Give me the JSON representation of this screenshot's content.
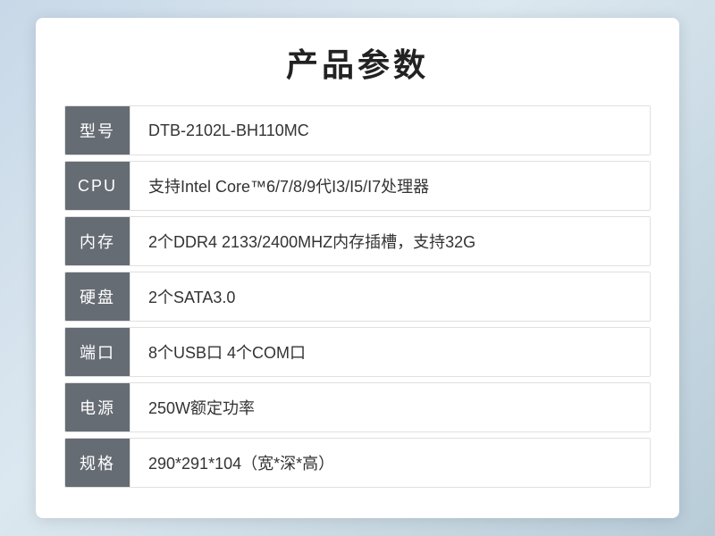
{
  "title": "产品参数",
  "specs": [
    {
      "label": "型号",
      "value": "DTB-2102L-BH110MC"
    },
    {
      "label": "CPU",
      "value": "支持Intel Core™6/7/8/9代I3/I5/I7处理器"
    },
    {
      "label": "内存",
      "value": "2个DDR4 2133/2400MHZ内存插槽，支持32G"
    },
    {
      "label": "硬盘",
      "value": "2个SATA3.0"
    },
    {
      "label": "端口",
      "value": "8个USB口 4个COM口"
    },
    {
      "label": "电源",
      "value": "250W额定功率"
    },
    {
      "label": "规格",
      "value": "290*291*104（宽*深*高）"
    }
  ]
}
